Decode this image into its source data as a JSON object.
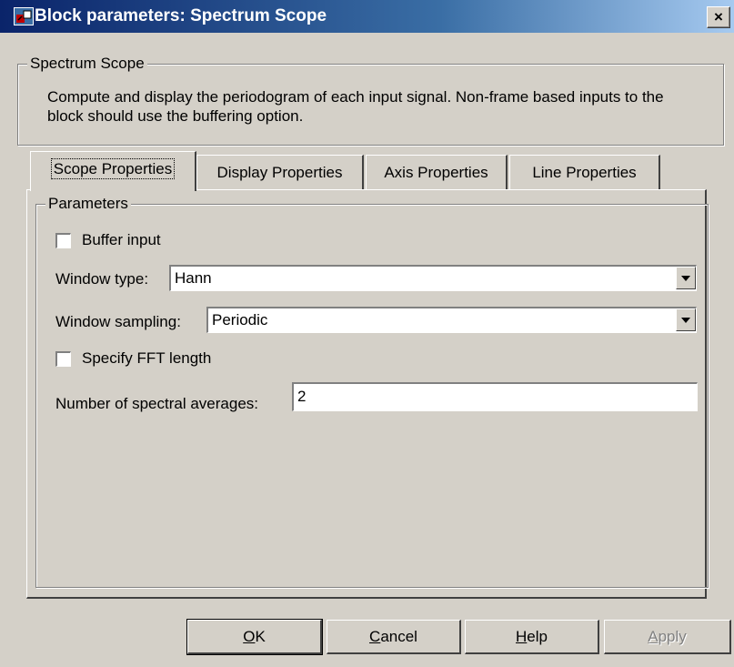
{
  "window": {
    "title": "Block parameters: Spectrum Scope",
    "close_label": "×"
  },
  "block": {
    "group_title": "Spectrum Scope",
    "description": "Compute and display the periodogram of each input signal.  Non-frame based inputs to the block should use the buffering option."
  },
  "tabs": [
    {
      "label": "Scope Properties",
      "active": true
    },
    {
      "label": "Display Properties",
      "active": false
    },
    {
      "label": "Axis Properties",
      "active": false
    },
    {
      "label": "Line Properties",
      "active": false
    }
  ],
  "parameters": {
    "group_title": "Parameters",
    "buffer_input": {
      "label": "Buffer input",
      "checked": false
    },
    "window_type": {
      "label": "Window type:",
      "value": "Hann"
    },
    "window_sampling": {
      "label": "Window sampling:",
      "value": "Periodic"
    },
    "specify_fft": {
      "label": "Specify FFT length",
      "checked": false
    },
    "spectral_averages": {
      "label": "Number of spectral averages:",
      "value": "2"
    }
  },
  "buttons": {
    "ok": {
      "accel": "O",
      "rest": "K"
    },
    "cancel": {
      "accel": "C",
      "rest": "ancel"
    },
    "help": {
      "accel": "H",
      "rest": "elp"
    },
    "apply": {
      "accel": "A",
      "rest": "pply",
      "enabled": false
    }
  }
}
